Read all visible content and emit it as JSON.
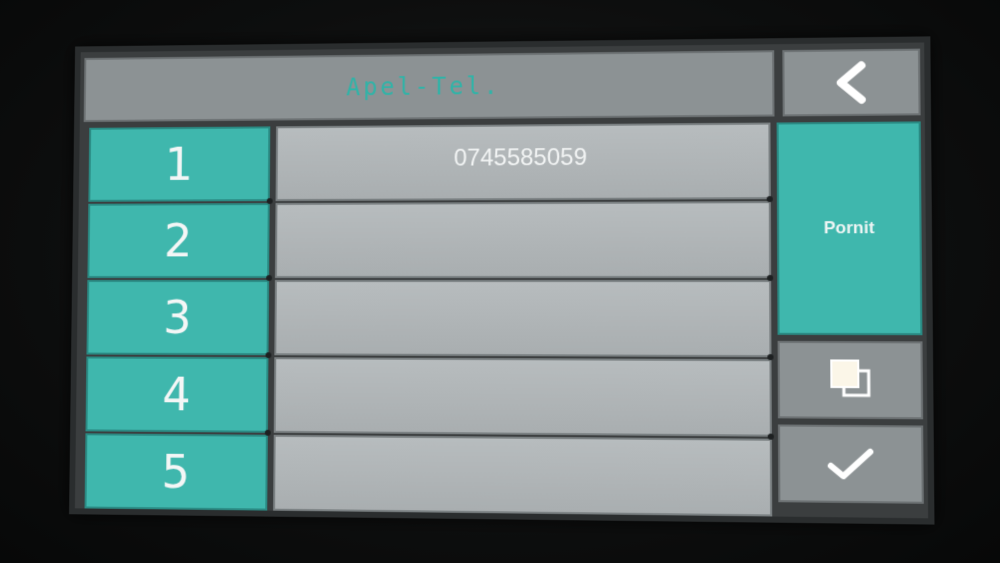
{
  "header": {
    "title": "Apel-Tel.",
    "back_icon": "chevron-left-icon"
  },
  "rows": [
    {
      "index": "1",
      "value": "0745585059"
    },
    {
      "index": "2",
      "value": ""
    },
    {
      "index": "3",
      "value": ""
    },
    {
      "index": "4",
      "value": ""
    },
    {
      "index": "5",
      "value": ""
    }
  ],
  "side": {
    "start_label": "Pornit",
    "copy_icon": "copy-icon",
    "confirm_icon": "checkmark-icon"
  },
  "colors": {
    "accent_teal": "#3fb7ad",
    "panel_gray": "#8c9294",
    "title_text": "#2fb4a8"
  }
}
